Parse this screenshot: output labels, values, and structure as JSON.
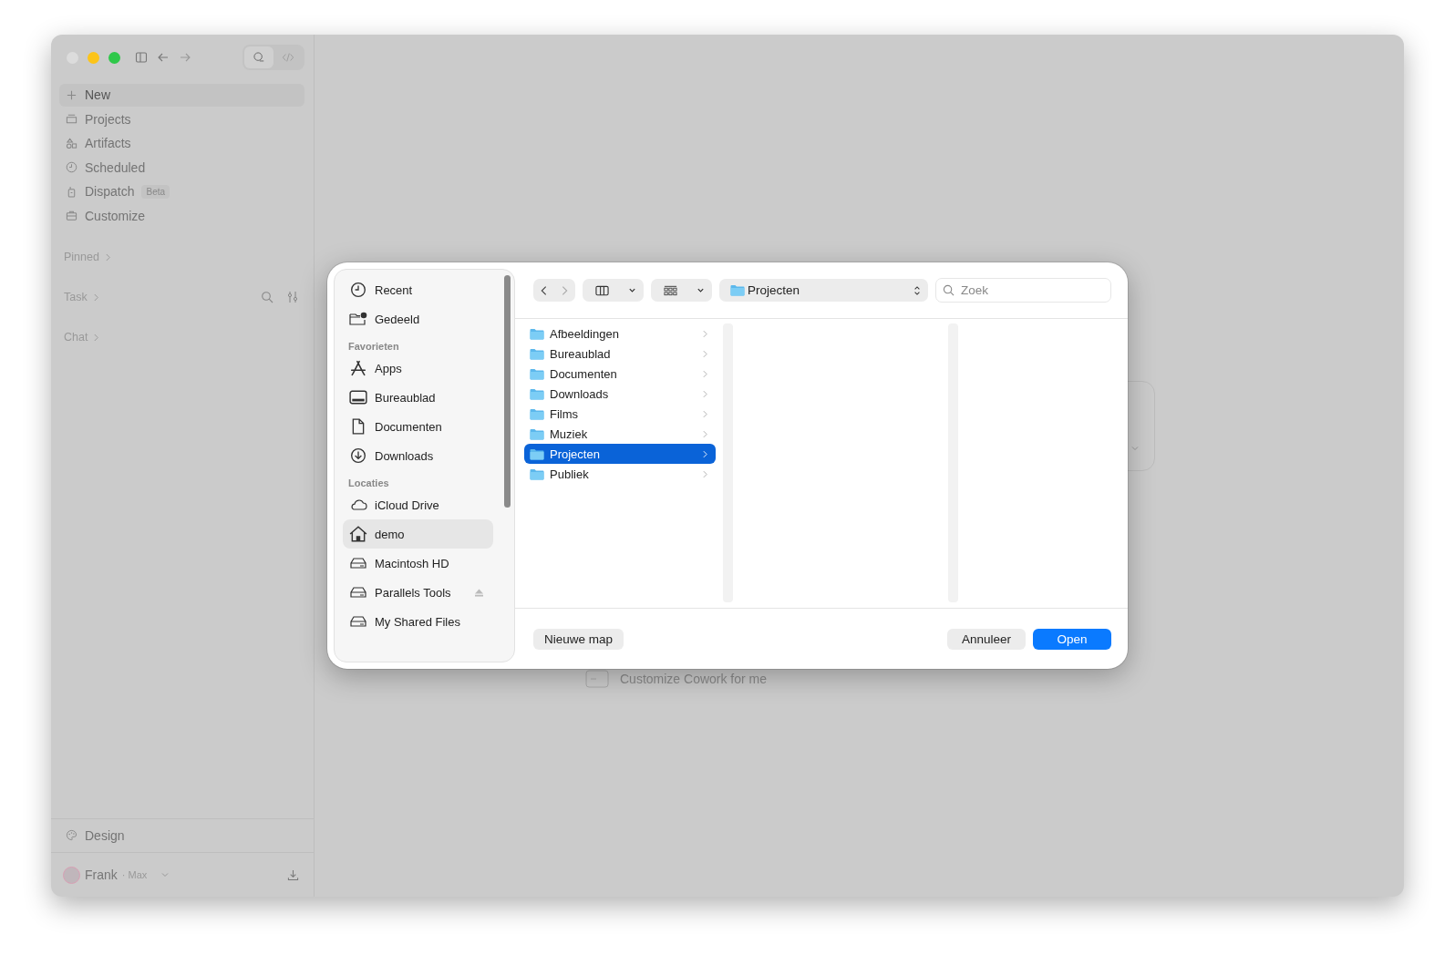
{
  "sidebar": {
    "modes": [
      {
        "selected": true
      },
      {
        "selected": false
      }
    ],
    "nav": [
      {
        "label": "New",
        "selected": true
      },
      {
        "label": "Projects",
        "selected": false
      },
      {
        "label": "Artifacts",
        "selected": false
      },
      {
        "label": "Scheduled",
        "selected": false
      },
      {
        "label": "Dispatch",
        "selected": false,
        "badge": "Beta"
      },
      {
        "label": "Customize",
        "selected": false
      }
    ],
    "sections": [
      {
        "label": "Pinned",
        "tools": false
      },
      {
        "label": "Task",
        "tools": true
      },
      {
        "label": "Chat",
        "tools": false
      }
    ],
    "footer_item": "Design",
    "user": {
      "name": "Frank",
      "plan": "· Max"
    }
  },
  "background": {
    "suggestion": "Customize Cowork for me"
  },
  "dialog": {
    "places": [
      {
        "label": "Recent",
        "selected": false
      },
      {
        "label": "Gedeeld",
        "selected": false
      }
    ],
    "groups": [
      {
        "title": "Favorieten",
        "items": [
          {
            "label": "Apps",
            "selected": false,
            "ejectable": false
          },
          {
            "label": "Bureaublad",
            "selected": false,
            "ejectable": false
          },
          {
            "label": "Documenten",
            "selected": false,
            "ejectable": false
          },
          {
            "label": "Downloads",
            "selected": false,
            "ejectable": false
          }
        ]
      },
      {
        "title": "Locaties",
        "items": [
          {
            "label": "iCloud Drive",
            "selected": false,
            "ejectable": false
          },
          {
            "label": "demo",
            "selected": true,
            "ejectable": false
          },
          {
            "label": "Macintosh HD",
            "selected": false,
            "ejectable": false
          },
          {
            "label": "Parallels Tools",
            "selected": false,
            "ejectable": true
          },
          {
            "label": "My Shared Files",
            "selected": false,
            "ejectable": false
          }
        ]
      }
    ],
    "path": "Projecten",
    "search": {
      "placeholder": "Zoek"
    },
    "folders": [
      {
        "label": "Afbeeldingen",
        "selected": false
      },
      {
        "label": "Bureaublad",
        "selected": false
      },
      {
        "label": "Documenten",
        "selected": false
      },
      {
        "label": "Downloads",
        "selected": false
      },
      {
        "label": "Films",
        "selected": false
      },
      {
        "label": "Muziek",
        "selected": false
      },
      {
        "label": "Projecten",
        "selected": true
      },
      {
        "label": "Publiek",
        "selected": false
      }
    ],
    "buttons": {
      "new_folder": "Nieuwe map",
      "cancel": "Annuleer",
      "confirm": "Open"
    }
  }
}
